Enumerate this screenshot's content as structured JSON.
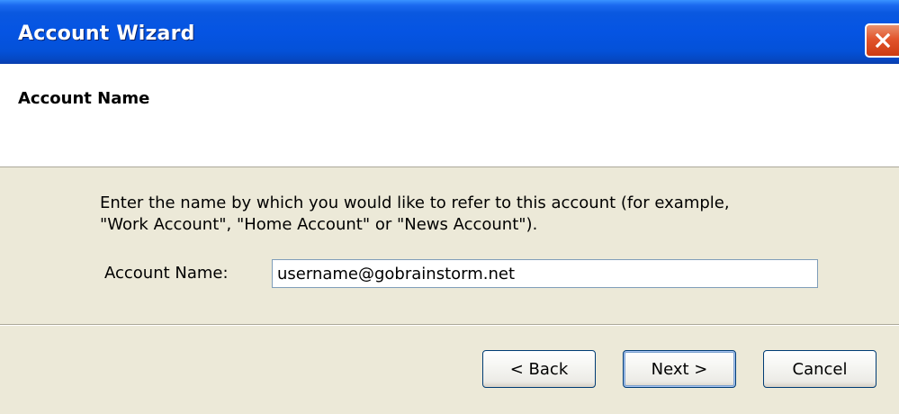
{
  "window": {
    "title": "Account Wizard"
  },
  "header": {
    "title": "Account Name"
  },
  "body": {
    "instructions": "Enter the name by which you would like to refer to this account (for example,\n\"Work Account\", \"Home Account\" or \"News Account\").",
    "account_name_label": "Account Name:",
    "account_name_value": "username@gobrainstorm.net"
  },
  "buttons": {
    "back_label": "< Back",
    "next_label": "Next >",
    "cancel_label": "Cancel"
  },
  "icons": {
    "close": "close-icon"
  },
  "colors": {
    "titlebar": "#0554e3",
    "close_button": "#e2552c",
    "dialog_background": "#ece9d8",
    "header_background": "#ffffff",
    "input_border": "#7f9db9"
  }
}
